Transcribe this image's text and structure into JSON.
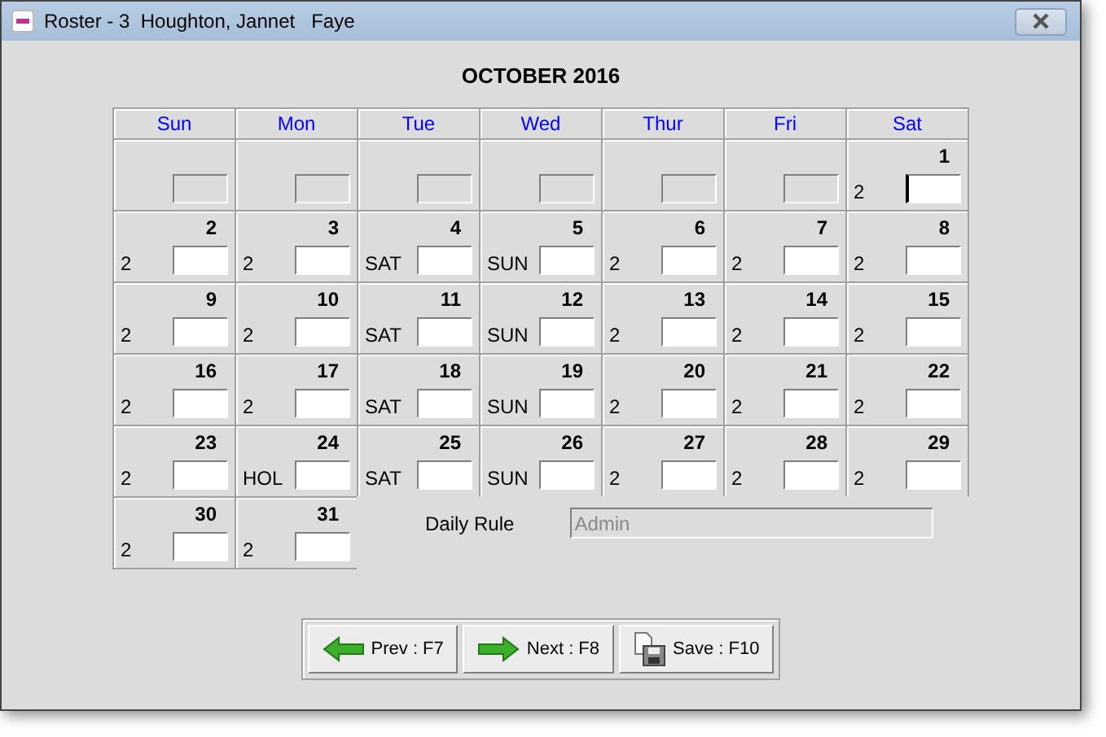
{
  "window": {
    "title": "Roster - 3  Houghton, Jannet   Faye"
  },
  "calendar": {
    "month": "OCTOBER 2016",
    "weekdays": [
      "Sun",
      "Mon",
      "Tue",
      "Wed",
      "Thur",
      "Fri",
      "Sat"
    ],
    "weeks": [
      [
        {
          "disabled": true,
          "focused": false
        },
        {
          "disabled": true,
          "focused": false
        },
        {
          "disabled": true,
          "focused": false
        },
        {
          "disabled": true,
          "focused": false
        },
        {
          "disabled": true,
          "focused": false
        },
        {
          "disabled": true,
          "focused": false
        },
        {
          "day": "1",
          "label": "2",
          "disabled": false,
          "focused": true
        }
      ],
      [
        {
          "day": "2",
          "label": "2",
          "disabled": false,
          "focused": false
        },
        {
          "day": "3",
          "label": "2",
          "disabled": false,
          "focused": false
        },
        {
          "day": "4",
          "label": "SAT",
          "disabled": false,
          "focused": false
        },
        {
          "day": "5",
          "label": "SUN",
          "disabled": false,
          "focused": false
        },
        {
          "day": "6",
          "label": "2",
          "disabled": false,
          "focused": false
        },
        {
          "day": "7",
          "label": "2",
          "disabled": false,
          "focused": false
        },
        {
          "day": "8",
          "label": "2",
          "disabled": false,
          "focused": false
        }
      ],
      [
        {
          "day": "9",
          "label": "2",
          "disabled": false,
          "focused": false
        },
        {
          "day": "10",
          "label": "2",
          "disabled": false,
          "focused": false
        },
        {
          "day": "11",
          "label": "SAT",
          "disabled": false,
          "focused": false
        },
        {
          "day": "12",
          "label": "SUN",
          "disabled": false,
          "focused": false
        },
        {
          "day": "13",
          "label": "2",
          "disabled": false,
          "focused": false
        },
        {
          "day": "14",
          "label": "2",
          "disabled": false,
          "focused": false
        },
        {
          "day": "15",
          "label": "2",
          "disabled": false,
          "focused": false
        }
      ],
      [
        {
          "day": "16",
          "label": "2",
          "disabled": false,
          "focused": false
        },
        {
          "day": "17",
          "label": "2",
          "disabled": false,
          "focused": false
        },
        {
          "day": "18",
          "label": "SAT",
          "disabled": false,
          "focused": false
        },
        {
          "day": "19",
          "label": "SUN",
          "disabled": false,
          "focused": false
        },
        {
          "day": "20",
          "label": "2",
          "disabled": false,
          "focused": false
        },
        {
          "day": "21",
          "label": "2",
          "disabled": false,
          "focused": false
        },
        {
          "day": "22",
          "label": "2",
          "disabled": false,
          "focused": false
        }
      ],
      [
        {
          "day": "23",
          "label": "2",
          "disabled": false,
          "focused": false
        },
        {
          "day": "24",
          "label": "HOL",
          "disabled": false,
          "focused": false
        },
        {
          "day": "25",
          "label": "SAT",
          "disabled": false,
          "focused": false
        },
        {
          "day": "26",
          "label": "SUN",
          "disabled": false,
          "focused": false
        },
        {
          "day": "27",
          "label": "2",
          "disabled": false,
          "focused": false
        },
        {
          "day": "28",
          "label": "2",
          "disabled": false,
          "focused": false
        },
        {
          "day": "29",
          "label": "2",
          "disabled": false,
          "focused": false
        }
      ],
      [
        {
          "day": "30",
          "label": "2",
          "disabled": false,
          "focused": false
        },
        {
          "day": "31",
          "label": "2",
          "disabled": false,
          "focused": false
        }
      ]
    ]
  },
  "daily_rule": {
    "label": "Daily Rule",
    "value": "Admin",
    "disabled": true
  },
  "buttons": [
    {
      "kind": "prev",
      "label": "Prev : F7"
    },
    {
      "kind": "next",
      "label": "Next : F8"
    },
    {
      "kind": "save",
      "label": "Save : F10"
    }
  ]
}
